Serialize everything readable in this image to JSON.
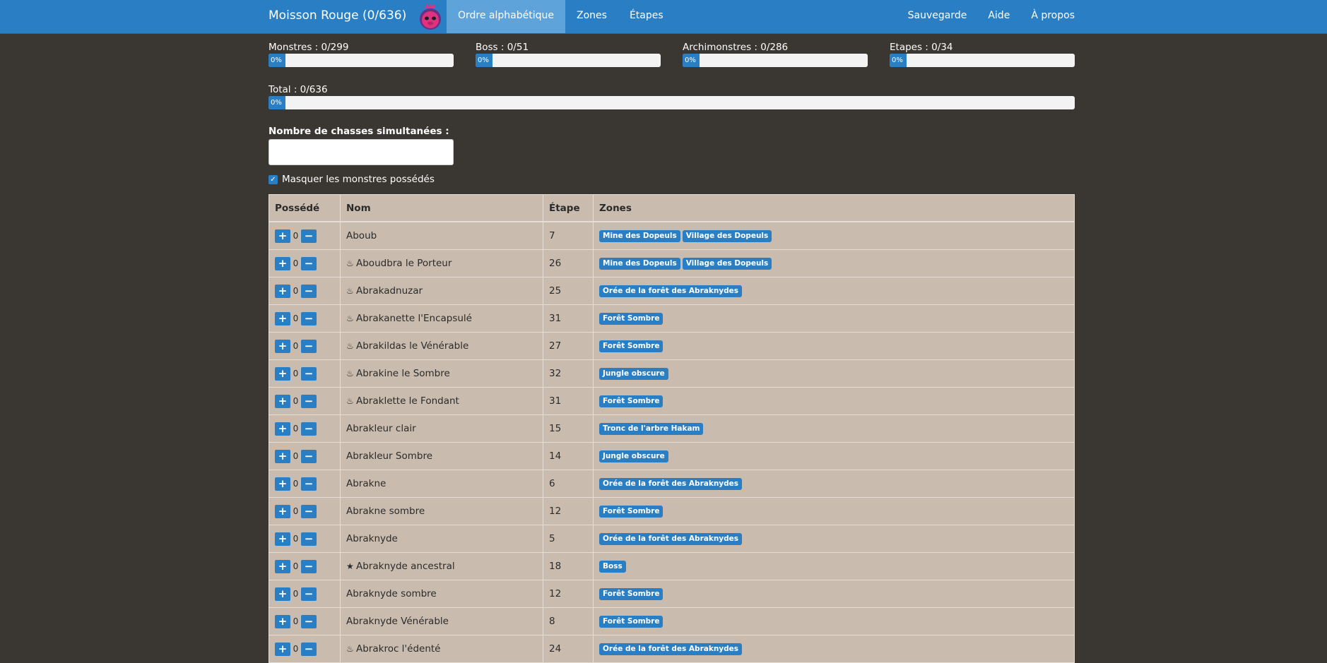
{
  "nav": {
    "brand": "Moisson Rouge (0/636)",
    "left": [
      "Ordre alphabétique",
      "Zones",
      "Étapes"
    ],
    "right": [
      "Sauvegarde",
      "Aide",
      "À propos"
    ]
  },
  "stats": {
    "monstres": {
      "label": "Monstres : 0/299",
      "percent_text": "0%",
      "progress": 0
    },
    "boss": {
      "label": "Boss : 0/51",
      "percent_text": "0%",
      "progress": 0
    },
    "archi": {
      "label": "Archimonstres : 0/286",
      "percent_text": "0%",
      "progress": 0
    },
    "etapes": {
      "label": "Etapes : 0/34",
      "percent_text": "0%",
      "progress": 0
    },
    "total": {
      "label": "Total : 0/636",
      "percent_text": "0%",
      "progress": 0
    }
  },
  "hunts": {
    "label": "Nombre de chasses simultanées :",
    "value": ""
  },
  "hide_owned": {
    "label": "Masquer les monstres possédés",
    "checked": true
  },
  "table": {
    "headers": [
      "Possédé",
      "Nom",
      "Étape",
      "Zones"
    ],
    "rows": [
      {
        "count": "0",
        "icon": "",
        "name": "Aboub",
        "step": "7",
        "zones": [
          "Mine des Dopeuls",
          "Village des Dopeuls"
        ]
      },
      {
        "count": "0",
        "icon": "flame",
        "name": "Aboudbra le Porteur",
        "step": "26",
        "zones": [
          "Mine des Dopeuls",
          "Village des Dopeuls"
        ]
      },
      {
        "count": "0",
        "icon": "flame",
        "name": "Abrakadnuzar",
        "step": "25",
        "zones": [
          "Orée de la forêt des Abraknydes"
        ]
      },
      {
        "count": "0",
        "icon": "flame",
        "name": "Abrakanette l'Encapsulé",
        "step": "31",
        "zones": [
          "Forêt Sombre"
        ]
      },
      {
        "count": "0",
        "icon": "flame",
        "name": "Abrakildas le Vénérable",
        "step": "27",
        "zones": [
          "Forêt Sombre"
        ]
      },
      {
        "count": "0",
        "icon": "flame",
        "name": "Abrakine le Sombre",
        "step": "32",
        "zones": [
          "Jungle obscure"
        ]
      },
      {
        "count": "0",
        "icon": "flame",
        "name": "Abraklette le Fondant",
        "step": "31",
        "zones": [
          "Forêt Sombre"
        ]
      },
      {
        "count": "0",
        "icon": "",
        "name": "Abrakleur clair",
        "step": "15",
        "zones": [
          "Tronc de l'arbre Hakam"
        ]
      },
      {
        "count": "0",
        "icon": "",
        "name": "Abrakleur Sombre",
        "step": "14",
        "zones": [
          "Jungle obscure"
        ]
      },
      {
        "count": "0",
        "icon": "",
        "name": "Abrakne",
        "step": "6",
        "zones": [
          "Orée de la forêt des Abraknydes"
        ]
      },
      {
        "count": "0",
        "icon": "",
        "name": "Abrakne sombre",
        "step": "12",
        "zones": [
          "Forêt Sombre"
        ]
      },
      {
        "count": "0",
        "icon": "",
        "name": "Abraknyde",
        "step": "5",
        "zones": [
          "Orée de la forêt des Abraknydes"
        ]
      },
      {
        "count": "0",
        "icon": "star",
        "name": "Abraknyde ancestral",
        "step": "18",
        "zones": [
          "Boss"
        ]
      },
      {
        "count": "0",
        "icon": "",
        "name": "Abraknyde sombre",
        "step": "12",
        "zones": [
          "Forêt Sombre"
        ]
      },
      {
        "count": "0",
        "icon": "",
        "name": "Abraknyde Vénérable",
        "step": "8",
        "zones": [
          "Forêt Sombre"
        ]
      },
      {
        "count": "0",
        "icon": "flame",
        "name": "Abrakroc l'édenté",
        "step": "24",
        "zones": [
          "Orée de la forêt des Abraknydes"
        ]
      }
    ]
  },
  "colors": {
    "primary": "#2a7fc4",
    "background": "#3a3732",
    "table_bg": "#c9bcae"
  }
}
